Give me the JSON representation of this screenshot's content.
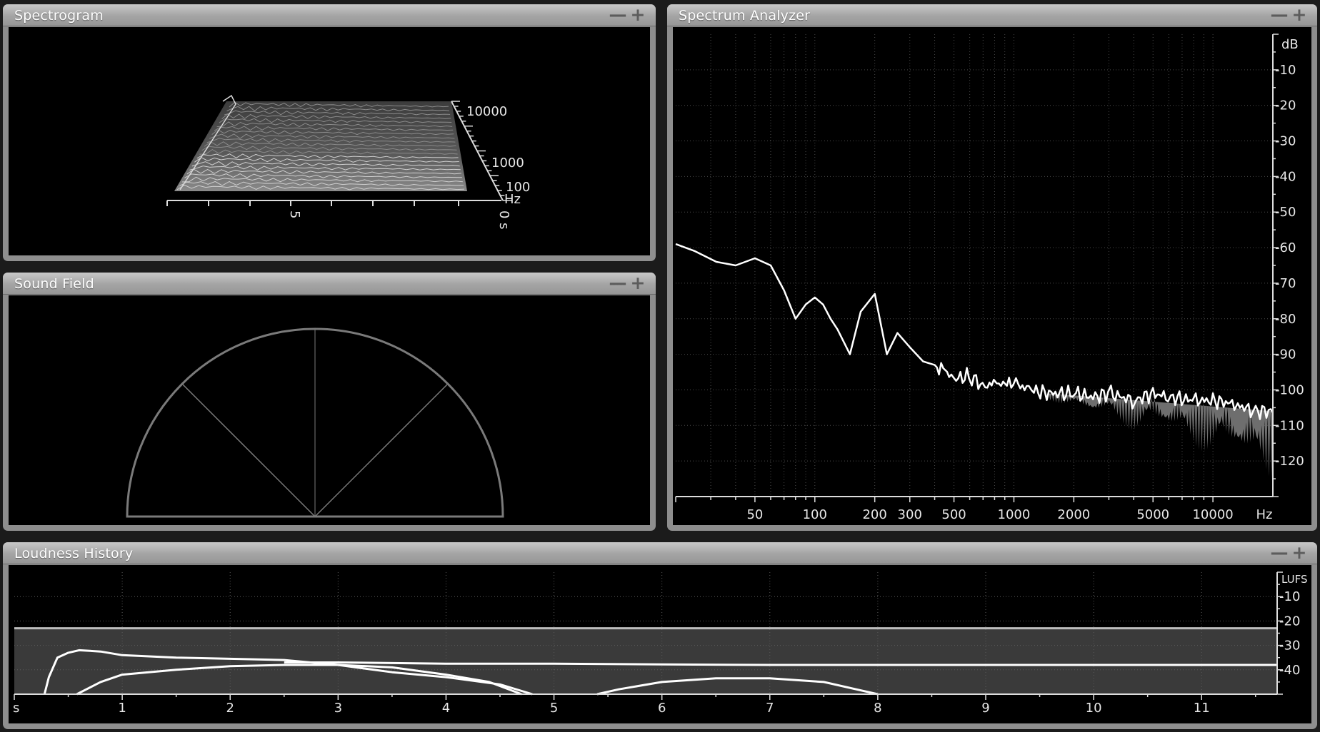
{
  "panels": {
    "spectrogram": {
      "title": "Spectrogram",
      "freq_ticks": [
        "10000",
        "1000",
        "100"
      ],
      "freq_unit": "Hz",
      "time_ticks": [
        "5",
        "0 s"
      ]
    },
    "sound_field": {
      "title": "Sound Field"
    },
    "spectrum": {
      "title": "Spectrum Analyzer",
      "db_unit": "dB",
      "db_ticks": [
        "-10",
        "-20",
        "-30",
        "-40",
        "-50",
        "-60",
        "-70",
        "-80",
        "-90",
        "-100",
        "-110",
        "-120"
      ],
      "freq_ticks": [
        "50",
        "100",
        "200",
        "300",
        "500",
        "1000",
        "2000",
        "5000",
        "10000"
      ],
      "freq_unit": "Hz"
    },
    "loudness": {
      "title": "Loudness History",
      "lufs_unit": "LUFS",
      "lufs_ticks": [
        "-10",
        "-20",
        "-30",
        "-40"
      ],
      "time_unit": "s",
      "time_ticks": [
        "1",
        "2",
        "3",
        "4",
        "5",
        "6",
        "7",
        "8",
        "9",
        "10",
        "11"
      ]
    }
  },
  "controls": {
    "minimize_symbol": "—",
    "maximize_symbol": "+"
  },
  "chart_data": [
    {
      "type": "line",
      "title": "Spectrum Analyzer",
      "xlabel": "Hz",
      "ylabel": "dB",
      "x_scale": "log",
      "xlim": [
        20,
        20000
      ],
      "ylim": [
        -130,
        0
      ],
      "grid": true,
      "series": [
        {
          "x": [
            20,
            25,
            32,
            40,
            50,
            60,
            70,
            80,
            90,
            100,
            110,
            120,
            130,
            150,
            170,
            200,
            230,
            260,
            300,
            350,
            400,
            450,
            500,
            600,
            700,
            800,
            900,
            1000,
            1200,
            1500,
            2000,
            2500,
            3000,
            4000,
            5000,
            6000,
            8000,
            10000,
            13000,
            16000,
            20000
          ],
          "y": [
            -59,
            -61,
            -64,
            -65,
            -63,
            -65,
            -72,
            -80,
            -76,
            -74,
            -76,
            -80,
            -83,
            -90,
            -78,
            -73,
            -90,
            -84,
            -88,
            -92,
            -93,
            -95,
            -97,
            -96,
            -99,
            -98,
            -99,
            -98,
            -100,
            -101,
            -101,
            -102,
            -101,
            -103,
            -101,
            -102,
            -103,
            -103,
            -104,
            -106,
            -106
          ]
        }
      ]
    },
    {
      "type": "line",
      "title": "Loudness History",
      "xlabel": "s",
      "ylabel": "LUFS",
      "xlim": [
        0,
        11.7
      ],
      "ylim": [
        -50,
        0
      ],
      "grid": true,
      "reference_level": -23,
      "series": [
        {
          "x": [
            0.28,
            0.32,
            0.4,
            0.5,
            0.6,
            0.8,
            1.0,
            1.5,
            2.0,
            2.5,
            3.0,
            3.5,
            4.0,
            4.5,
            4.8
          ],
          "y": [
            -50,
            -43,
            -35,
            -33,
            -32,
            -32.5,
            -34,
            -35,
            -35.5,
            -36,
            -38,
            -41,
            -43,
            -46,
            -50
          ]
        },
        {
          "x": [
            0.58,
            0.8,
            1.0,
            1.5,
            2.0,
            2.5,
            3.0,
            3.5,
            4.0,
            4.4,
            4.7
          ],
          "y": [
            -50,
            -45,
            -42,
            -40,
            -38.5,
            -38,
            -38,
            -39,
            -42,
            -45,
            -50
          ]
        },
        {
          "x": [
            5.4,
            5.6,
            6.0,
            6.5,
            7.0,
            7.5,
            7.8,
            8.0
          ],
          "y": [
            -50,
            -48,
            -45,
            -43.5,
            -43.5,
            -45,
            -48,
            -50
          ]
        },
        {
          "x": [
            2.5,
            3.0,
            4.0,
            5.0,
            6.0,
            7.0,
            8.0,
            9.0,
            10.0,
            11.0,
            11.7
          ],
          "y": [
            -37,
            -37,
            -37.5,
            -37.5,
            -37.8,
            -38,
            -38,
            -38,
            -38,
            -38,
            -38
          ]
        }
      ]
    }
  ]
}
